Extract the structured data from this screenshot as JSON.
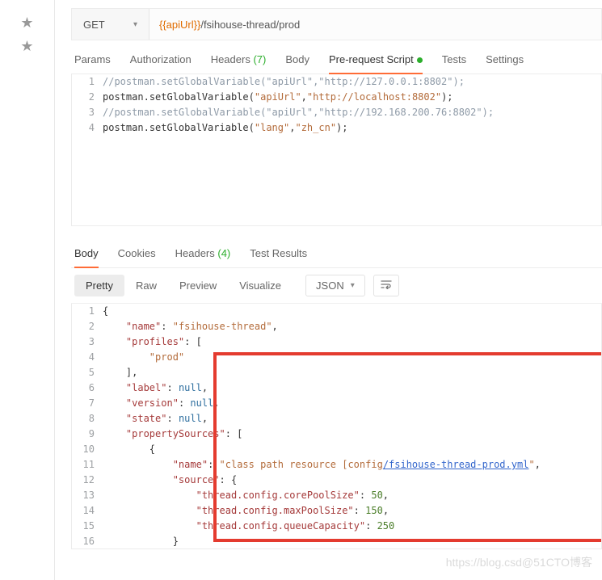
{
  "stars": [
    "★",
    "★"
  ],
  "request": {
    "method": "GET",
    "urlVar": "{{apiUrl}}",
    "urlPath": "/fsihouse-thread/prod"
  },
  "reqTabs": {
    "params": "Params",
    "auth": "Authorization",
    "headers": "Headers",
    "headersCount": "(7)",
    "body": "Body",
    "prs": "Pre-request Script",
    "tests": "Tests",
    "settings": "Settings"
  },
  "script": {
    "lines": [
      {
        "n": "1",
        "t": "comment",
        "text": "//postman.setGlobalVariable(\"apiUrl\",\"http://127.0.0.1:8802\");"
      },
      {
        "n": "2",
        "t": "code",
        "obj": "postman",
        "fn": "setGlobalVariable",
        "a1": "\"apiUrl\"",
        "a2": "\"http://localhost:8802\""
      },
      {
        "n": "3",
        "t": "comment",
        "text": "//postman.setGlobalVariable(\"apiUrl\",\"http://192.168.200.76:8802\");"
      },
      {
        "n": "4",
        "t": "code",
        "obj": "postman",
        "fn": "setGlobalVariable",
        "a1": "\"lang\"",
        "a2": "\"zh_cn\""
      }
    ]
  },
  "respTabs": {
    "body": "Body",
    "cookies": "Cookies",
    "headers": "Headers",
    "headersCount": "(4)",
    "tests": "Test Results"
  },
  "respTool": {
    "pretty": "Pretty",
    "raw": "Raw",
    "preview": "Preview",
    "visualize": "Visualize",
    "json": "JSON"
  },
  "resp": [
    {
      "n": "1",
      "i": 0,
      "p": [
        {
          "c": "",
          "v": "{"
        }
      ]
    },
    {
      "n": "2",
      "i": 1,
      "p": [
        {
          "c": "key",
          "v": "\"name\""
        },
        {
          "c": "",
          "v": ": "
        },
        {
          "c": "str",
          "v": "\"fsihouse-thread\""
        },
        {
          "c": "",
          "v": ","
        }
      ]
    },
    {
      "n": "3",
      "i": 1,
      "p": [
        {
          "c": "key",
          "v": "\"profiles\""
        },
        {
          "c": "",
          "v": ": ["
        }
      ]
    },
    {
      "n": "4",
      "i": 2,
      "p": [
        {
          "c": "str",
          "v": "\"prod\""
        }
      ]
    },
    {
      "n": "5",
      "i": 1,
      "p": [
        {
          "c": "",
          "v": "],"
        }
      ]
    },
    {
      "n": "6",
      "i": 1,
      "p": [
        {
          "c": "key",
          "v": "\"label\""
        },
        {
          "c": "",
          "v": ": "
        },
        {
          "c": "null",
          "v": "null"
        },
        {
          "c": "",
          "v": ","
        }
      ]
    },
    {
      "n": "7",
      "i": 1,
      "p": [
        {
          "c": "key",
          "v": "\"version\""
        },
        {
          "c": "",
          "v": ": "
        },
        {
          "c": "null",
          "v": "null"
        },
        {
          "c": "",
          "v": ","
        }
      ]
    },
    {
      "n": "8",
      "i": 1,
      "p": [
        {
          "c": "key",
          "v": "\"state\""
        },
        {
          "c": "",
          "v": ": "
        },
        {
          "c": "null",
          "v": "null"
        },
        {
          "c": "",
          "v": ","
        }
      ]
    },
    {
      "n": "9",
      "i": 1,
      "p": [
        {
          "c": "key",
          "v": "\"propertySources\""
        },
        {
          "c": "",
          "v": ": ["
        }
      ]
    },
    {
      "n": "10",
      "i": 2,
      "p": [
        {
          "c": "",
          "v": "{"
        }
      ]
    },
    {
      "n": "11",
      "i": 3,
      "p": [
        {
          "c": "key",
          "v": "\"name\""
        },
        {
          "c": "",
          "v": ": "
        },
        {
          "c": "str",
          "v": "\"class path resource [config"
        },
        {
          "c": "link",
          "v": "/fsihouse-thread-prod.yml"
        },
        {
          "c": "str",
          "v": "\""
        },
        {
          "c": "",
          "v": ","
        }
      ]
    },
    {
      "n": "12",
      "i": 3,
      "p": [
        {
          "c": "key",
          "v": "\"source\""
        },
        {
          "c": "",
          "v": ": {"
        }
      ]
    },
    {
      "n": "13",
      "i": 4,
      "p": [
        {
          "c": "key",
          "v": "\"thread.config.corePoolSize\""
        },
        {
          "c": "",
          "v": ": "
        },
        {
          "c": "num",
          "v": "50"
        },
        {
          "c": "",
          "v": ","
        }
      ]
    },
    {
      "n": "14",
      "i": 4,
      "p": [
        {
          "c": "key",
          "v": "\"thread.config.maxPoolSize\""
        },
        {
          "c": "",
          "v": ": "
        },
        {
          "c": "num",
          "v": "150"
        },
        {
          "c": "",
          "v": ","
        }
      ]
    },
    {
      "n": "15",
      "i": 4,
      "p": [
        {
          "c": "key",
          "v": "\"thread.config.queueCapacity\""
        },
        {
          "c": "",
          "v": ": "
        },
        {
          "c": "num",
          "v": "250"
        }
      ]
    },
    {
      "n": "16",
      "i": 3,
      "p": [
        {
          "c": "",
          "v": "}"
        }
      ]
    }
  ],
  "watermark": "https://blog.csd@51CTO博客"
}
